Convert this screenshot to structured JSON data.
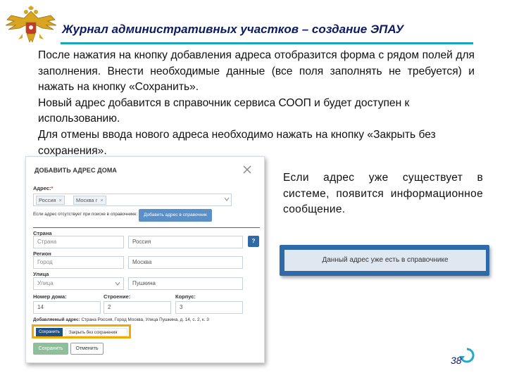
{
  "header": {
    "title": "Журнал административных участков – создание ЭПАУ"
  },
  "intro": {
    "p1": "После нажатия на кнопку добавления адреса отобразится форма с рядом полей для заполнения. Внести необходимые данные (все поля заполнять не требуется) и нажать на кнопку «Сохранить».",
    "p2": "Новый адрес добавится в справочник сервиса СООП и будет доступен к использованию.",
    "p3": "Для отмены ввода нового адреса необходимо нажать на кнопку «Закрыть без сохранения»."
  },
  "dialog": {
    "title": "ДОБАВИТЬ АДРЕС ДОМА",
    "address_label": "Адрес:",
    "required_mark": "*",
    "address_tags": [
      "Россия",
      "Москва г"
    ],
    "tag_remove": "×",
    "not_found_note": "Если адрес отсутствует при поиске в справочнике:",
    "add_to_directory_button": "Добавить адрес в справочник",
    "country_label": "Страна",
    "country_select_placeholder": "Страна",
    "country_value": "Россия",
    "help_button": "?",
    "region_label": "Регион",
    "region_select_placeholder": "Город",
    "region_value": "Москва",
    "street_label": "Улица",
    "street_select_placeholder": "Улица",
    "street_value": "Пушкина",
    "house_label": "Номер дома:",
    "house_value": "14",
    "building_label": "Строение:",
    "building_value": "2",
    "block_label": "Корпус:",
    "block_value": "3",
    "added_label": "Добавляемый адрес:",
    "added_value": "Страна Россия, Город Москва, Улица Пушкина, д. 14, с. 2, к. 3",
    "save_small_button": "Сохранить",
    "close_without_save_button": "Закрыть без сохранения",
    "save_button": "Сохранить",
    "cancel_button": "Отменить"
  },
  "side_text": "Если адрес уже существует в системе, появится информационное сообщение.",
  "message": "Данный адрес уже есть в справочнике",
  "page_number": "38",
  "colors": {
    "title": "#0d1a63",
    "accent_line": "#1aa7b8",
    "highlight": "#f2a900",
    "message_frame": "#2f6aa8"
  },
  "icons": [
    "double-headed-eagle-emblem",
    "close-icon",
    "chevron-down-icon",
    "help-icon",
    "refresh-arrow-icon"
  ]
}
